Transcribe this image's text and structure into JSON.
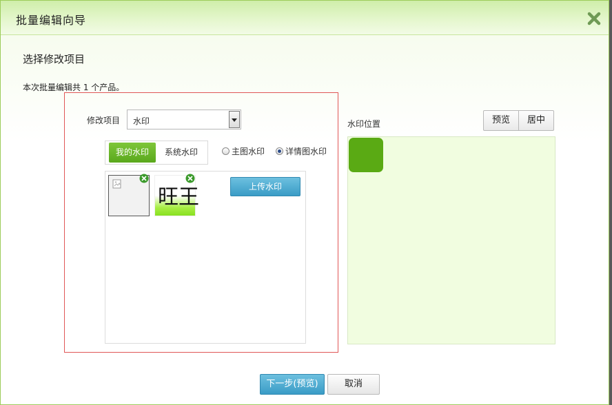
{
  "dialog": {
    "title": "批量编辑向导",
    "close_icon": "close-icon"
  },
  "main": {
    "section_title": "选择修改项目",
    "info_text": "本次批量编辑共 1 个产品。"
  },
  "editor": {
    "field_label": "修改项目",
    "select_value": "水印",
    "tabs": [
      {
        "label": "我的水印",
        "active": true
      },
      {
        "label": "系统水印",
        "active": false
      }
    ],
    "radios": [
      {
        "label": "主图水印",
        "checked": false
      },
      {
        "label": "详情图水印",
        "checked": true
      }
    ],
    "thumb2_text_left": "旺",
    "thumb2_text_right": "王",
    "upload_label": "上传水印"
  },
  "position_panel": {
    "label": "水印位置",
    "preview_label": "预览",
    "center_label": "居中"
  },
  "footer": {
    "next_label": "下一步(预览)",
    "cancel_label": "取消"
  },
  "colors": {
    "accent_green": "#5aaa14",
    "accent_blue": "#3a9cc6",
    "highlight_border": "#e05555"
  }
}
